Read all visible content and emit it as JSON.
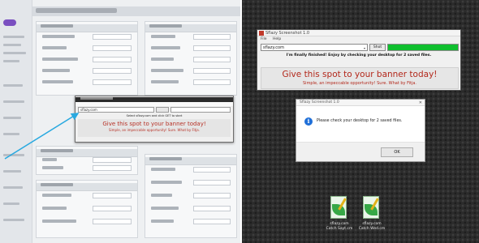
{
  "app_window": {
    "title": "Sflazy Screenshot 1.0",
    "menu": [
      "File",
      "Help"
    ],
    "url_value": "sflazy.com",
    "go_label": "Shot",
    "progress": 1.0,
    "status": "I'm finally finished! Enjoy by checking your desktop for 2 saved files.",
    "ad_headline": "Give this spot to your banner today!",
    "ad_subline": "Simple, an impeccable opportunity!        Sure. What by Fitja."
  },
  "dialog": {
    "title": "Sflazy Screenshot 1.0",
    "close_glyph": "✕",
    "info_glyph": "i",
    "message": "Please check your desktop for 2 saved files.",
    "ok_label": "OK"
  },
  "desktop_icons": [
    {
      "name": "page-leaf-icon",
      "caption": "sflazy.com\nCatch Sayt.cm"
    },
    {
      "name": "page-leaf-icon",
      "caption": "sflazy.com\nCatch Wed.cm"
    }
  ],
  "left_mini_window": {
    "url_value": "sflazy.com",
    "status": "Select sflazy.com and click GET to start",
    "ad_headline": "Give this spot to your banner today!",
    "ad_subline": "Simple, an impeccable opportunity!    Sure. What by Fitja."
  },
  "colors": {
    "progress_fill": "#0fbf2e",
    "ad_text": "#b3281b",
    "arrow": "#29a9e0",
    "info_icon": "#1f6fd8",
    "desktop_bg": "#2b2b2b"
  }
}
